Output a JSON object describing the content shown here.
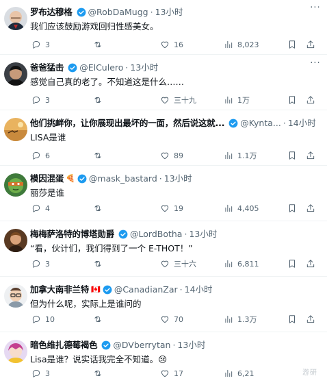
{
  "tweets": [
    {
      "name": "罗布达穆格",
      "flag": "",
      "handle": "@RobDaMugg",
      "time": "13小时",
      "text": "我们应该鼓励游戏回归性感美女。",
      "replies": "3",
      "retweets": "",
      "likes": "16",
      "views": "8,023",
      "avatar": "bald-man-avatar"
    },
    {
      "name": "爸爸猛击",
      "flag": "",
      "handle": "@ElCulero",
      "time": "13小时",
      "text": "感觉自己真的老了。不知道这是什么……",
      "replies": "3",
      "retweets": "",
      "likes": "三十九",
      "views": "1万",
      "avatar": "dark-hair-avatar"
    },
    {
      "name": "他们挑衅你，让你展现出最坏的一面，然后说这就...",
      "flag": "",
      "handle": "@Kynta...",
      "time": "14小时",
      "text": "LISA是谁",
      "replies": "6",
      "retweets": "",
      "likes": "89",
      "views": "1.1万",
      "avatar": "desert-avatar"
    },
    {
      "name": "模因混蛋",
      "flag": "🍕",
      "handle": "@mask_bastard",
      "time": "13小时",
      "text": "丽莎是谁",
      "replies": "4",
      "retweets": "",
      "likes": "19",
      "views": "4,405",
      "avatar": "turtle-avatar"
    },
    {
      "name": "梅梅萨洛特的博塔勋爵",
      "flag": "",
      "handle": "@LordBotha",
      "time": "13小时",
      "text": "“看，伙计们，我们得到了一个 E-THOT！”",
      "replies": "3",
      "retweets": "",
      "likes": "三十六",
      "views": "6,811",
      "avatar": "portrait-avatar"
    },
    {
      "name": "加拿大南非兰特",
      "flag": "🇨🇦",
      "handle": "@CanadianZar",
      "time": "14小时",
      "text": "但为什么呢，实际上是谁问的",
      "replies": "10",
      "retweets": "",
      "likes": "70",
      "views": "1.3万",
      "avatar": "cartoon-avatar"
    },
    {
      "name": "暗色维扎德莓褐色",
      "flag": "",
      "handle": "@DVberrytan",
      "time": "13小时",
      "text": "Lisa是谁？说实话我完全不知道。😢",
      "replies": "3",
      "retweets": "",
      "likes": "17",
      "views": "6,21",
      "avatar": "anime-avatar"
    }
  ],
  "more_label": "···",
  "dot": "·",
  "watermark": "游研",
  "colors": {
    "verified": "#1d9bf0",
    "muted": "#536471",
    "text": "#0f1419",
    "divider": "#eff3f4"
  }
}
